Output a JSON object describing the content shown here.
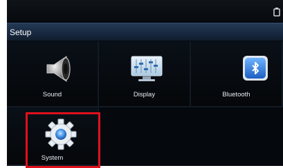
{
  "screen": {
    "title": "Setup"
  },
  "tiles": [
    {
      "label": "Sound",
      "icon": "speaker-icon"
    },
    {
      "label": "Display",
      "icon": "display-equalizer-icon"
    },
    {
      "label": "Bluetooth",
      "icon": "bluetooth-icon"
    },
    {
      "label": "System",
      "icon": "gear-icon"
    }
  ],
  "selected": "System",
  "colors": {
    "highlight": "#e0101c",
    "titlebar": "#1a2d45",
    "background": "#05080d",
    "bluetooth": "#2f7de0"
  }
}
